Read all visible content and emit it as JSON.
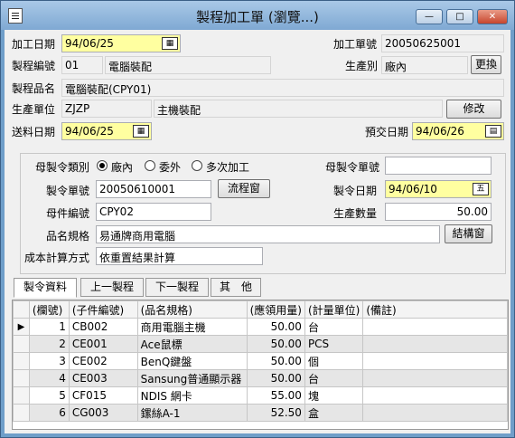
{
  "window": {
    "title": "製程加工單 (瀏覽...)",
    "min_label": "—",
    "max_label": "□",
    "close_label": "✕"
  },
  "header": {
    "process_date_label": "加工日期",
    "process_date": "94/06/25",
    "process_no_label": "加工單號",
    "process_no": "20050625001",
    "proc_code_label": "製程編號",
    "proc_code": "01",
    "proc_code_name": "電腦裝配",
    "prod_type_label": "生產別",
    "prod_type": "廠內",
    "change_button": "更換",
    "proc_product_label": "製程品名",
    "proc_product": "電腦裝配(CPY01)",
    "unit_label": "生產單位",
    "unit_code": "ZJZP",
    "unit_name": "主機裝配",
    "edit_button": "修改",
    "send_date_label": "送料日期",
    "send_date": "94/06/25",
    "due_date_label": "預交日期",
    "due_date": "94/06/26"
  },
  "parent_order": {
    "type_label": "母製令類別",
    "opt_inhouse": "廠內",
    "opt_outsource": "委外",
    "opt_multi": "多次加工",
    "parent_no_label": "母製令單號",
    "parent_no": "",
    "order_no_label": "製令單號",
    "order_no": "20050610001",
    "flow_button": "流程窗",
    "order_date_label": "製令日期",
    "order_date": "94/06/10",
    "parent_code_label": "母件編號",
    "parent_code": "CPY02",
    "qty_label": "生產數量",
    "qty": "50.00",
    "spec_label": "品名規格",
    "spec": "易通牌商用電腦",
    "struct_button": "結構窗",
    "cost_label": "成本計算方式",
    "cost_method": "依重置結果計算"
  },
  "tabs": [
    "製令資料",
    "上一製程",
    "下一製程",
    "其　他"
  ],
  "table": {
    "columns": [
      "(欄號)",
      "(子件編號)",
      "(品名規格)",
      "(應領用量)",
      "(計量單位)",
      "(備註)"
    ],
    "rows": [
      {
        "no": "1",
        "code": "CB002",
        "name": "商用電腦主機",
        "qty": "50.00",
        "unit": "台",
        "note": ""
      },
      {
        "no": "2",
        "code": "CE001",
        "name": "Ace鼠標",
        "qty": "50.00",
        "unit": "PCS",
        "note": ""
      },
      {
        "no": "3",
        "code": "CE002",
        "name": "BenQ鍵盤",
        "qty": "50.00",
        "unit": "個",
        "note": ""
      },
      {
        "no": "4",
        "code": "CE003",
        "name": "Sansung普通顯示器",
        "qty": "50.00",
        "unit": "台",
        "note": ""
      },
      {
        "no": "5",
        "code": "CF015",
        "name": "NDIS 網卡",
        "qty": "55.00",
        "unit": "塊",
        "note": ""
      },
      {
        "no": "6",
        "code": "CG003",
        "name": "鏍絲A-1",
        "qty": "52.50",
        "unit": "盒",
        "note": ""
      }
    ]
  }
}
